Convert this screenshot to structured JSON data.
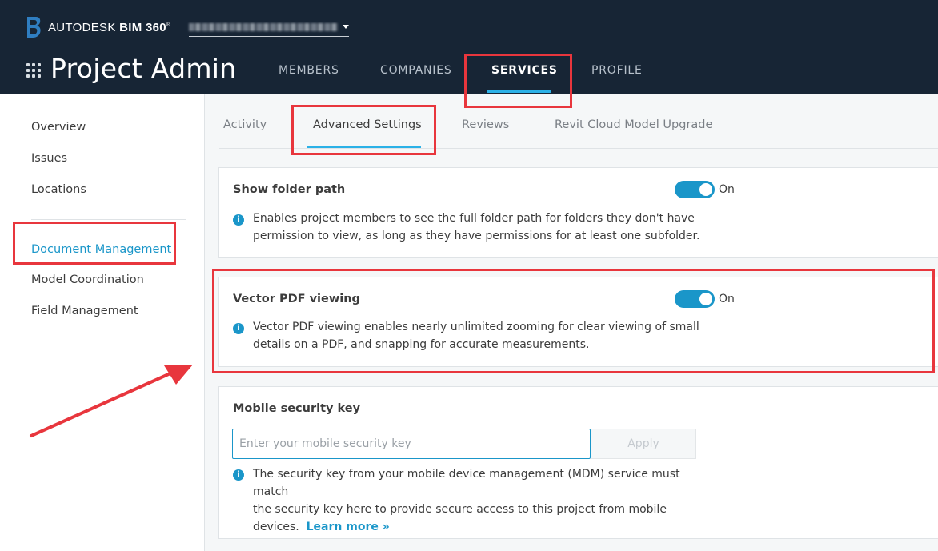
{
  "header": {
    "brand_prefix": "AUTODESK",
    "brand_product": "BIM 360",
    "brand_mark": "®",
    "app_title": "Project Admin",
    "nav": [
      {
        "label": "MEMBERS"
      },
      {
        "label": "COMPANIES"
      },
      {
        "label": "SERVICES",
        "active": true
      },
      {
        "label": "PROFILE"
      }
    ]
  },
  "sidebar": {
    "items": [
      {
        "label": "Overview"
      },
      {
        "label": "Issues"
      },
      {
        "label": "Locations"
      },
      {
        "label": "Document Management",
        "active": true
      },
      {
        "label": "Model Coordination"
      },
      {
        "label": "Field Management"
      }
    ]
  },
  "subtabs": [
    {
      "label": "Activity"
    },
    {
      "label": "Advanced Settings",
      "active": true
    },
    {
      "label": "Reviews"
    },
    {
      "label": "Revit Cloud Model Upgrade"
    }
  ],
  "settings": {
    "folder_path": {
      "title": "Show folder path",
      "toggle_state": "On",
      "enabled": true,
      "desc_line1": "Enables project members to see the full folder path for folders they don't have",
      "desc_line2": "permission to view, as long as they have permissions for at least one subfolder."
    },
    "vector_pdf": {
      "title": "Vector PDF viewing",
      "toggle_state": "On",
      "enabled": true,
      "desc_line1": "Vector PDF viewing enables nearly unlimited zooming for clear viewing of small",
      "desc_line2": "details on a PDF, and snapping for accurate measurements."
    },
    "mobile_key": {
      "title": "Mobile security key",
      "placeholder": "Enter your mobile security key",
      "value": "",
      "apply_label": "Apply",
      "desc_line1": "The security key from your mobile device management (MDM) service must match",
      "desc_line2": "the security key here to provide secure access to this project from mobile",
      "desc_line3": "devices.",
      "learn_more": "Learn more »"
    }
  },
  "info_icon_glyph": "i",
  "colors": {
    "header_bg": "#172535",
    "accent": "#1a96c9",
    "nav_underline": "#2bb1e7",
    "annotation_red": "#e8363d"
  }
}
